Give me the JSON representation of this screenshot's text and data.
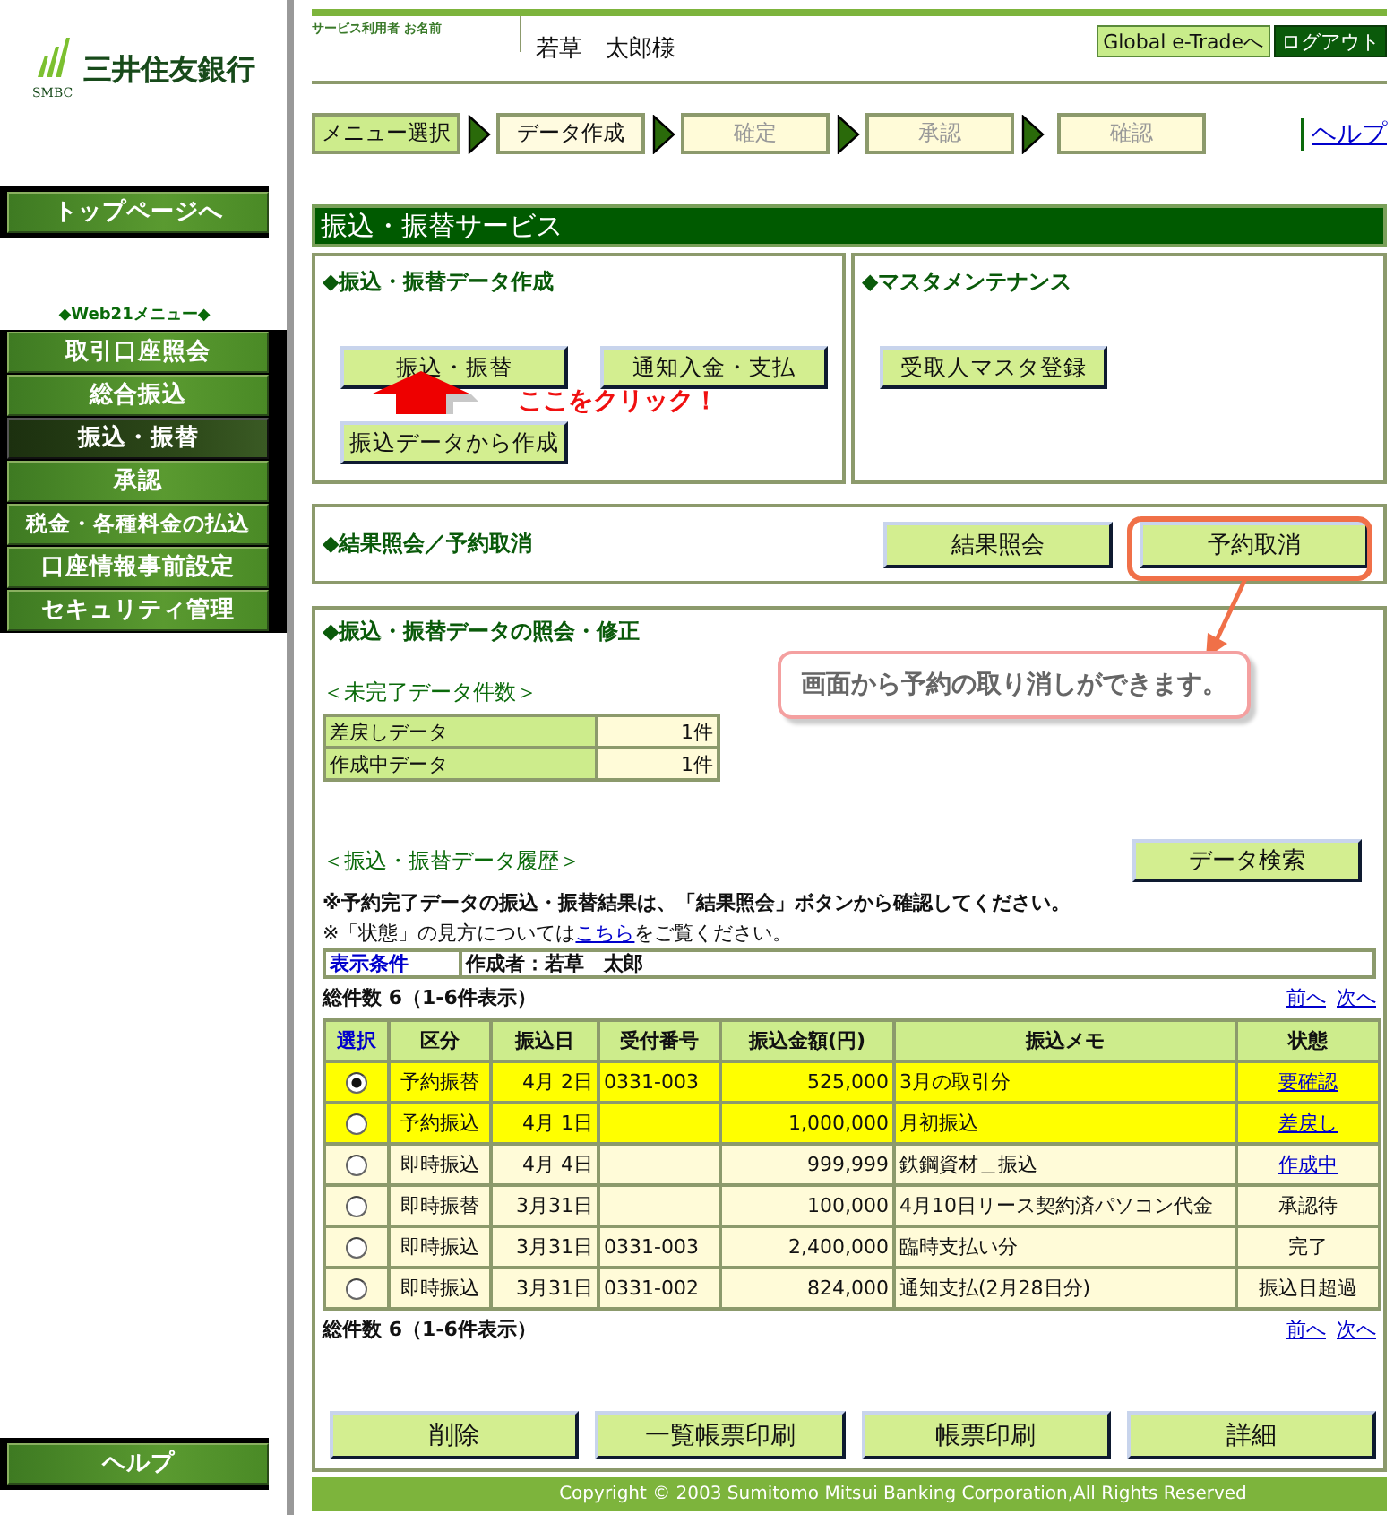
{
  "logo": {
    "name": "三井住友銀行",
    "abbr": "SMBC"
  },
  "sidebar": {
    "top_button": "トップページへ",
    "menu_title": "◆Web21メニュー◆",
    "items": [
      {
        "label": "取引口座照会",
        "selected": false
      },
      {
        "label": "総合振込",
        "selected": false
      },
      {
        "label": "振込・振替",
        "selected": true
      },
      {
        "label": "承認",
        "selected": false
      },
      {
        "label": "税金・各種料金の払込",
        "selected": false
      },
      {
        "label": "口座情報事前設定",
        "selected": false
      },
      {
        "label": "セキュリティ管理",
        "selected": false
      }
    ],
    "help_button": "ヘルプ"
  },
  "header": {
    "user_caption": "サービス利用者 お名前",
    "user_name": "若草　太郎様",
    "buttons": [
      "Global e-Tradeへ",
      "ログアウト"
    ]
  },
  "steps": [
    {
      "label": "メニュー選択",
      "completed": true,
      "disabled": false
    },
    {
      "label": "データ作成",
      "completed": false,
      "disabled": false
    },
    {
      "label": "確定",
      "completed": false,
      "disabled": true
    },
    {
      "label": "承認",
      "completed": false,
      "disabled": true
    },
    {
      "label": "確認",
      "completed": false,
      "disabled": true
    }
  ],
  "help_link": "ヘルプ",
  "page_title": "振込・振替サービス",
  "create_panel": {
    "heading": "◆振込・振替データ作成",
    "buttons": [
      "振込・振替",
      "通知入金・支払",
      "振込データから作成"
    ]
  },
  "master_panel": {
    "heading": "◆マスタメンテナンス",
    "buttons": [
      "受取人マスタ登録"
    ]
  },
  "result_panel": {
    "heading": "◆結果照会／予約取消",
    "buttons": [
      "結果照会",
      "予約取消"
    ]
  },
  "inquiry": {
    "heading": "◆振込・振替データの照会・修正",
    "pending_heading": "＜未完了データ件数＞",
    "pending": [
      {
        "label": "差戻しデータ",
        "count": "1件"
      },
      {
        "label": "作成中データ",
        "count": "1件"
      }
    ],
    "history_heading": "＜振込・振替データ履歴＞",
    "search_button": "データ検索",
    "note_bold": "※予約完了データの振込・振替結果は、「結果照会」ボタンから確認してください。",
    "note_before": "※「状態」の見方については",
    "note_link": "こちら",
    "note_after": "をご覧ください。",
    "filter_label": "表示条件",
    "filter_value": "作成者：若草　太郎",
    "total_top": "総件数 6（1-6件表示）",
    "total_bottom": "総件数 6（1-6件表示）",
    "pager_top": [
      "前へ",
      "次へ"
    ],
    "pager_bottom": [
      "前へ",
      "次へ"
    ],
    "columns": [
      "選択",
      "区分",
      "振込日",
      "受付番号",
      "振込金額(円)",
      "振込メモ",
      "状態"
    ],
    "rows": [
      {
        "selected": true,
        "highlighted": true,
        "type": "予約振替",
        "date": "4月 2日",
        "number": "0331-003",
        "amount": "525,000",
        "memo": "3月の取引分",
        "status": "要確認",
        "status_link": true
      },
      {
        "selected": false,
        "highlighted": true,
        "type": "予約振込",
        "date": "4月 1日",
        "number": "",
        "amount": "1,000,000",
        "memo": "月初振込",
        "status": "差戻し",
        "status_link": true
      },
      {
        "selected": false,
        "highlighted": false,
        "type": "即時振込",
        "date": "4月 4日",
        "number": "",
        "amount": "999,999",
        "memo": "鉄鋼資材＿振込",
        "status": "作成中",
        "status_link": true
      },
      {
        "selected": false,
        "highlighted": false,
        "type": "即時振替",
        "date": "3月31日",
        "number": "",
        "amount": "100,000",
        "memo": "4月10日リース契約済パソコン代金",
        "status": "承認待",
        "status_link": false
      },
      {
        "selected": false,
        "highlighted": false,
        "type": "即時振込",
        "date": "3月31日",
        "number": "0331-003",
        "amount": "2,400,000",
        "memo": "臨時支払い分",
        "status": "完了",
        "status_link": false
      },
      {
        "selected": false,
        "highlighted": false,
        "type": "即時振込",
        "date": "3月31日",
        "number": "0331-002",
        "amount": "824,000",
        "memo": "通知支払(2月28日分)",
        "status": "振込日超過",
        "status_link": false
      }
    ],
    "bottom_buttons": [
      "削除",
      "一覧帳票印刷",
      "帳票印刷",
      "詳細"
    ]
  },
  "annotations": {
    "click_hint": "ここをクリック！",
    "tip": "画面から予約の取り消しができます。"
  },
  "copyright": "Copyright © 2003 Sumitomo Mitsui Banking Corporation,All Rights Reserved"
}
